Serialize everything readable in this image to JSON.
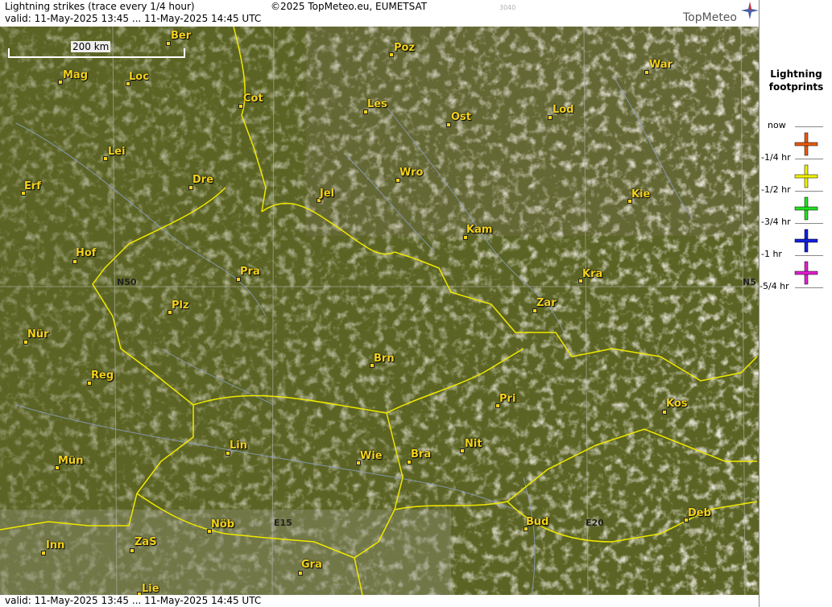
{
  "header": {
    "title": "Lightning strikes (trace every 1/4 hour)",
    "valid": "valid:  11-May-2025 13:45 ... 11-May-2025 14:45 UTC",
    "copyright": "©2025 TopMeteo.eu, EUMETSAT",
    "code": "3040",
    "logo": "TopMeteo"
  },
  "footer": {
    "valid": "valid:  11-May-2025 13:45 ... 11-May-2025 14:45 UTC"
  },
  "map": {
    "scale_label": "200 km",
    "grid_labels": [
      "N50",
      "N5",
      "E15",
      "E20"
    ],
    "cities": [
      {
        "name": "Ber"
      },
      {
        "name": "Poz"
      },
      {
        "name": "War"
      },
      {
        "name": "Mag"
      },
      {
        "name": "Loc"
      },
      {
        "name": "Cot"
      },
      {
        "name": "Les"
      },
      {
        "name": "Ost"
      },
      {
        "name": "Lod"
      },
      {
        "name": "Lei"
      },
      {
        "name": "Dre"
      },
      {
        "name": "Erf"
      },
      {
        "name": "Jel"
      },
      {
        "name": "Wro"
      },
      {
        "name": "Kie"
      },
      {
        "name": "Kam"
      },
      {
        "name": "Hof"
      },
      {
        "name": "Pra"
      },
      {
        "name": "Kra"
      },
      {
        "name": "Zar"
      },
      {
        "name": "Plz"
      },
      {
        "name": "Nür"
      },
      {
        "name": "Brn"
      },
      {
        "name": "Reg"
      },
      {
        "name": "Pri"
      },
      {
        "name": "Kos"
      },
      {
        "name": "Lin"
      },
      {
        "name": "Nit"
      },
      {
        "name": "Wie"
      },
      {
        "name": "Bra"
      },
      {
        "name": "Mün"
      },
      {
        "name": "Nöb"
      },
      {
        "name": "Bud"
      },
      {
        "name": "Deb"
      },
      {
        "name": "Inn"
      },
      {
        "name": "ZaS"
      },
      {
        "name": "Gra"
      },
      {
        "name": "Lie"
      }
    ]
  },
  "legend": {
    "title_line1": "Lightning",
    "title_line2": "footprints",
    "items": [
      {
        "label": "now",
        "color": "#e85a10"
      },
      {
        "label": "-1/4 hr",
        "color": "#f0f000"
      },
      {
        "label": "-1/2 hr",
        "color": "#20e020"
      },
      {
        "label": "-3/4 hr",
        "color": "#1020e0"
      },
      {
        "label": "-1 hr",
        "color": "#e020d0"
      },
      {
        "label": "-5/4 hr",
        "color": ""
      }
    ]
  },
  "colors": {
    "border": "#f0e800",
    "city": "#f4d21a",
    "land": "#5b6424",
    "cloud": "#d8d0c0",
    "river": "#8ea0d0"
  }
}
